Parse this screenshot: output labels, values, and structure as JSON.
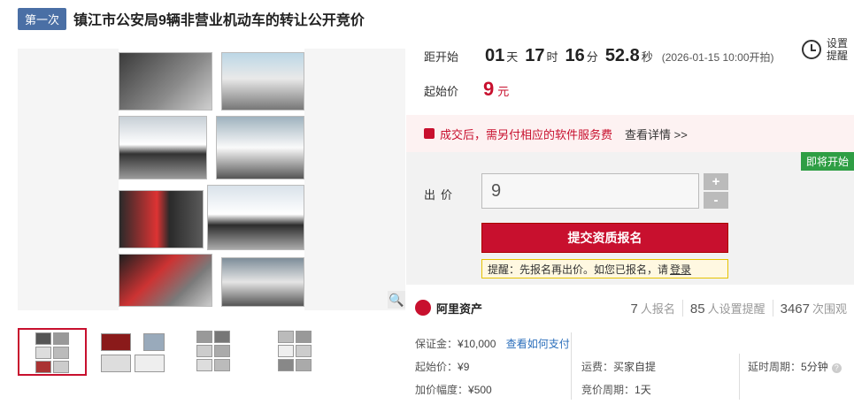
{
  "header": {
    "badge": "第一次",
    "title": "镇江市公安局9辆非营业机动车的转让公开竞价"
  },
  "countdown": {
    "label": "距开始",
    "days": "01",
    "days_unit": "天",
    "hours": "17",
    "hours_unit": "时",
    "minutes": "16",
    "minutes_unit": "分",
    "seconds": "52.8",
    "seconds_unit": "秒",
    "start_note": "(2026-01-15 10:00开拍)"
  },
  "reminder": {
    "line1": "设置",
    "line2": "提醒"
  },
  "start_price": {
    "label": "起始价",
    "value": "9",
    "unit": "元"
  },
  "notice": {
    "text": "成交后，需另付相应的软件服务费",
    "link": "查看详情 >>"
  },
  "bid": {
    "status_badge": "即将开始",
    "label": "出价",
    "value": "9",
    "plus": "+",
    "minus": "-",
    "submit_label": "提交资质报名",
    "tip_text": "提醒：先报名再出价。如您已报名，请",
    "tip_link": "登录"
  },
  "platform": {
    "name": "阿里资产"
  },
  "stats": [
    {
      "count": "7",
      "label": "人报名"
    },
    {
      "count": "85",
      "label": "人设置提醒"
    },
    {
      "count": "3467",
      "label": "次围观"
    }
  ],
  "details": {
    "deposit_label": "保证金：",
    "deposit_value": "¥10,000",
    "deposit_link": "查看如何支付",
    "start_label": "起始价：",
    "start_value": "¥9",
    "freight_label": "运费：",
    "freight_value": "买家自提",
    "delay_label": "延时周期：",
    "delay_value": "5分钟",
    "increment_label": "加价幅度：",
    "increment_value": "¥500",
    "period_label": "竞价周期：",
    "period_value": "1天"
  },
  "icons": {
    "zoom": "magnifier-icon",
    "reminder": "alarm-clock-icon",
    "notice": "bag-icon",
    "logo": "ali-asset-logo"
  },
  "colors": {
    "accent": "#c8102e",
    "badge_bg": "#4a6fa5",
    "status_green": "#2f9e44"
  }
}
